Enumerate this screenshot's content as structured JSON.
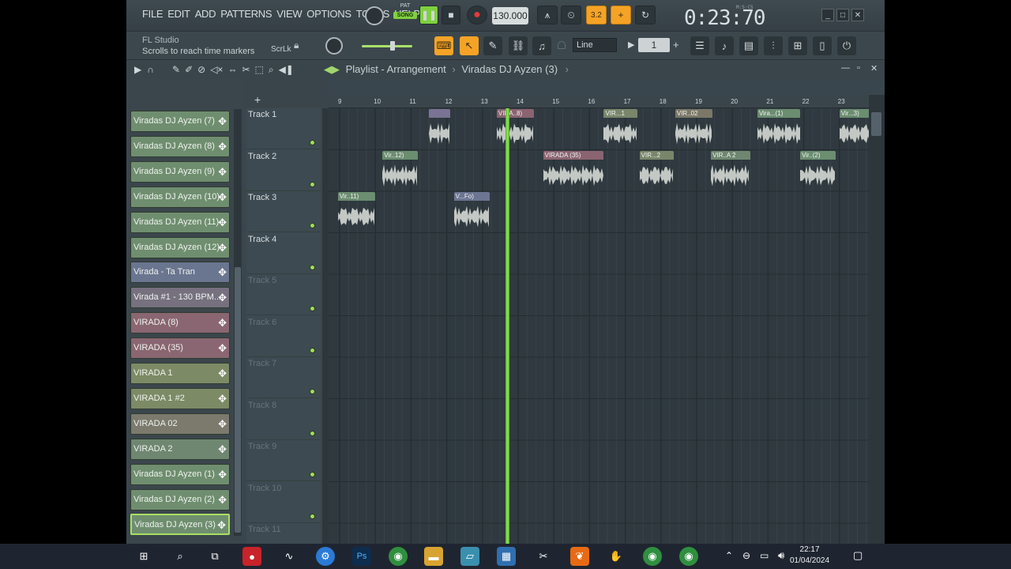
{
  "menu": [
    "FILE",
    "EDIT",
    "ADD",
    "PATTERNS",
    "VIEW",
    "OPTIONS",
    "TOOLS",
    "HELP"
  ],
  "transport": {
    "pat_label": "PAT",
    "song_label": "SONG",
    "tempo": "130.000",
    "pattern_num": "3.2",
    "time": "0:23:70",
    "time_label": "M:S:CS"
  },
  "hint": {
    "title": "FL Studio",
    "text": "Scrolls to reach time markers",
    "scrlk": "ScrLk"
  },
  "snap": {
    "mode": "Line",
    "value": "1"
  },
  "playlist": {
    "title": "Playlist - Arrangement",
    "crumb": "Viradas DJ Ayzen (3)"
  },
  "browser": {
    "items": [
      {
        "label": "Viradas DJ Ayzen (7)",
        "color": "#6f8e6f"
      },
      {
        "label": "Viradas DJ Ayzen (8)",
        "color": "#6f8e6f"
      },
      {
        "label": "Viradas DJ Ayzen (9)",
        "color": "#6f8e6f"
      },
      {
        "label": "Viradas DJ Ayzen (10)",
        "color": "#6f8e6f"
      },
      {
        "label": "Viradas DJ Ayzen (11)",
        "color": "#6f8e6f"
      },
      {
        "label": "Viradas DJ Ayzen (12)",
        "color": "#6f8e6f"
      },
      {
        "label": "Virada - Ta Tran",
        "color": "#6a7590"
      },
      {
        "label": "Virada #1 - 130 BPM...",
        "color": "#76707f"
      },
      {
        "label": "VIRADA (8)",
        "color": "#8a6672"
      },
      {
        "label": "VIRADA (35)",
        "color": "#8a6672"
      },
      {
        "label": "VIRADA 1",
        "color": "#7d8a66"
      },
      {
        "label": "VIRADA 1 #2",
        "color": "#7d8a66"
      },
      {
        "label": "VIRADA 02",
        "color": "#7b7a6c"
      },
      {
        "label": "VIRADA 2",
        "color": "#6f8770"
      },
      {
        "label": "Viradas DJ Ayzen (1)",
        "color": "#6f8e6f"
      },
      {
        "label": "Viradas DJ Ayzen (2)",
        "color": "#6f8e6f"
      },
      {
        "label": "Viradas DJ Ayzen (3)",
        "color": "#6f8e6f"
      }
    ]
  },
  "tracks": [
    "Track 1",
    "Track 2",
    "Track 3",
    "Track 4",
    "Track 5",
    "Track 6",
    "Track 7",
    "Track 8",
    "Track 9",
    "Track 10",
    "Track 11"
  ],
  "ruler": [
    "9",
    "10",
    "11",
    "12",
    "13",
    "14",
    "15",
    "16",
    "17",
    "18",
    "19",
    "20",
    "21",
    "22",
    "23"
  ],
  "clips": [
    {
      "track": 0,
      "bar": 11.5,
      "len": 0.6,
      "label": "",
      "color": "#7a7394"
    },
    {
      "track": 0,
      "bar": 13.4,
      "len": 1.05,
      "label": "VIRA..8)",
      "color": "#8a6470"
    },
    {
      "track": 0,
      "bar": 16.4,
      "len": 0.95,
      "label": "VIR...1",
      "color": "#79866a"
    },
    {
      "track": 0,
      "bar": 18.4,
      "len": 1.05,
      "label": "VIR..02",
      "color": "#7b7868"
    },
    {
      "track": 0,
      "bar": 20.7,
      "len": 1.2,
      "label": "Vira...(1)",
      "color": "#6b8d70"
    },
    {
      "track": 0,
      "bar": 23.0,
      "len": 1.0,
      "label": "Vir...3)",
      "color": "#6b8d70"
    },
    {
      "track": 1,
      "bar": 10.2,
      "len": 1.0,
      "label": "Vir..12)",
      "color": "#6b8d70"
    },
    {
      "track": 1,
      "bar": 14.7,
      "len": 1.7,
      "label": "VIRADA (35)",
      "color": "#8a6470"
    },
    {
      "track": 1,
      "bar": 17.4,
      "len": 0.95,
      "label": "VIR...2",
      "color": "#79866a"
    },
    {
      "track": 1,
      "bar": 19.4,
      "len": 1.1,
      "label": "VIR..A 2",
      "color": "#6f8770"
    },
    {
      "track": 1,
      "bar": 21.9,
      "len": 1.0,
      "label": "Vir..(2)",
      "color": "#6b8d70"
    },
    {
      "track": 2,
      "bar": 8.95,
      "len": 1.05,
      "label": "Vir..11)",
      "color": "#6b8d70"
    },
    {
      "track": 2,
      "bar": 12.2,
      "len": 1.0,
      "label": "V...Fo)",
      "color": "#6c7592"
    }
  ],
  "playhead_bar": 13.7,
  "taskbar": {
    "time": "22:17",
    "date": "01/04/2024"
  }
}
